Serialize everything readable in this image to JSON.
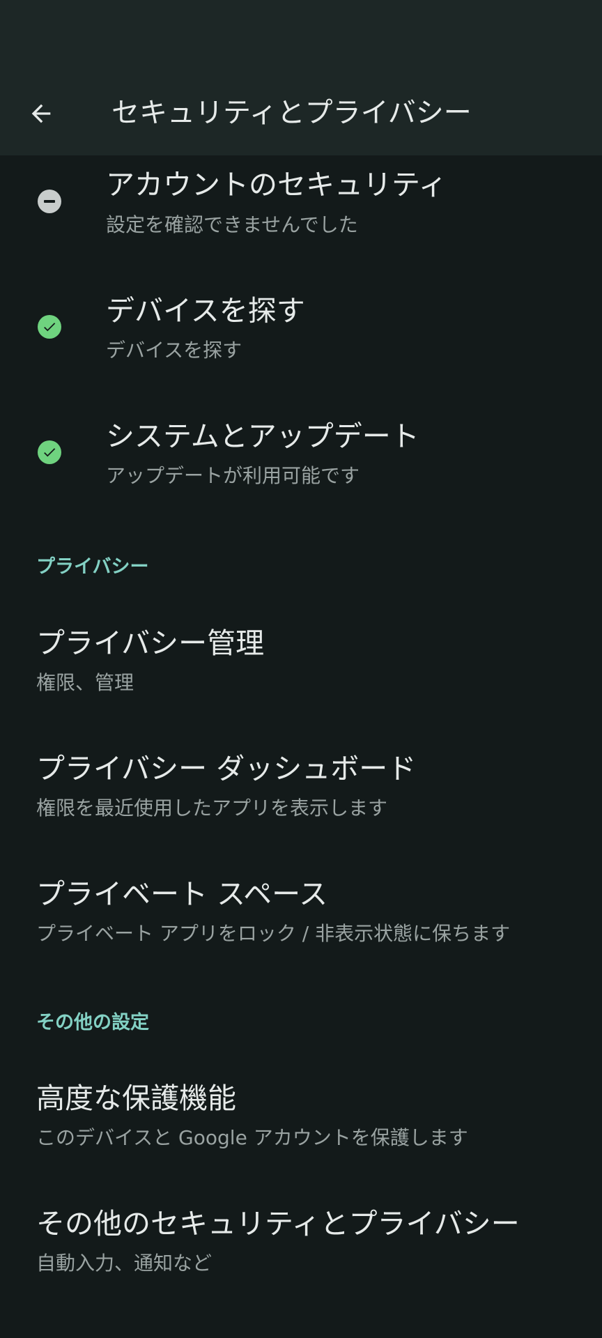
{
  "header": {
    "title": "セキュリティとプライバシー",
    "back_icon": "arrow-back-icon"
  },
  "status_items": [
    {
      "title": "アカウントのセキュリティ",
      "subtitle": "設定を確認できませんでした",
      "status": "neutral",
      "icon": "minus-circle-icon",
      "color": "#c8cdcc"
    },
    {
      "title": "デバイスを探す",
      "subtitle": "デバイスを探す",
      "status": "ok",
      "icon": "check-circle-icon",
      "color": "#6fd37f"
    },
    {
      "title": "システムとアップデート",
      "subtitle": "アップデートが利用可能です",
      "status": "ok",
      "icon": "check-circle-icon",
      "color": "#6fd37f"
    }
  ],
  "privacy_section": {
    "header": "プライバシー",
    "items": [
      {
        "title": "プライバシー管理",
        "subtitle": "権限、管理"
      },
      {
        "title": "プライバシー ダッシュボード",
        "subtitle": "権限を最近使用したアプリを表示します"
      },
      {
        "title": "プライベート スペース",
        "subtitle": "プライベート アプリをロック / 非表示状態に保ちます"
      }
    ]
  },
  "other_section": {
    "header": "その他の設定",
    "items": [
      {
        "title": "高度な保護機能",
        "subtitle": "このデバイスと Google アカウントを保護します"
      },
      {
        "title": "その他のセキュリティとプライバシー",
        "subtitle": "自動入力、通知など"
      }
    ]
  },
  "colors": {
    "background": "#131a1a",
    "appbar": "#1d2726",
    "accent": "#83d1c4",
    "ok_green": "#6fd37f"
  }
}
